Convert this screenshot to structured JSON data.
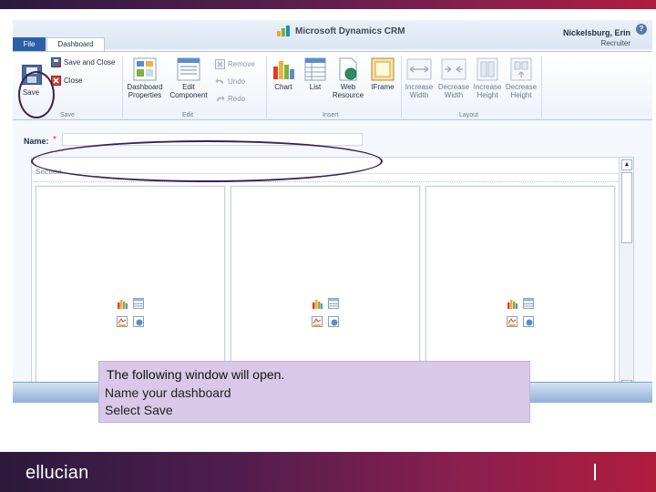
{
  "app": {
    "logo_text": "Microsoft Dynamics CRM",
    "user_name": "Nickelsburg, Erin",
    "user_role": "Recruiter",
    "help_glyph": "?"
  },
  "tabs": [
    {
      "label": "File"
    },
    {
      "label": "Dashboard"
    }
  ],
  "ribbon": {
    "save": {
      "label": "Save"
    },
    "save_and_close": {
      "label": "Save and Close"
    },
    "close": {
      "label": "Close"
    },
    "dashboard_properties": {
      "label_1": "Dashboard",
      "label_2": "Properties"
    },
    "edit_component": {
      "label_1": "Edit",
      "label_2": "Component"
    },
    "remove": {
      "label": "Remove"
    },
    "undo": {
      "label": "Undo"
    },
    "redo": {
      "label": "Redo"
    },
    "chart": {
      "label": "Chart"
    },
    "list": {
      "label": "List"
    },
    "web_resource": {
      "label_1": "Web",
      "label_2": "Resource"
    },
    "iframe": {
      "label": "IFrame"
    },
    "increase_width": {
      "label_1": "Increase",
      "label_2": "Width"
    },
    "decrease_width": {
      "label_1": "Decrease",
      "label_2": "Width"
    },
    "increase_height": {
      "label_1": "Increase",
      "label_2": "Height"
    },
    "decrease_height": {
      "label_1": "Decrease",
      "label_2": "Height"
    },
    "groups": [
      "Save",
      "Edit",
      "Insert",
      "Layout"
    ]
  },
  "form": {
    "name_label": "Name:",
    "required_marker": "*",
    "name_value": ""
  },
  "canvas": {
    "section_label": "Section"
  },
  "caption": {
    "title": "The following window will open.",
    "line1": "Name your dashboard",
    "line2": "Select Save"
  },
  "footer": {
    "logo": "ellucian"
  },
  "colors": {
    "accent_purple": "#3a1f57",
    "caption_bg": "#d9c8e8",
    "tab_file_blue": "#2c5fa7",
    "footer_left": "#2b1a3c",
    "footer_right": "#b01c3e",
    "required_red": "#d03030"
  },
  "icons": [
    "save-icon",
    "save-and-close-icon",
    "close-icon",
    "dashboard-properties-icon",
    "edit-component-icon",
    "remove-icon",
    "undo-icon",
    "redo-icon",
    "chart-icon",
    "list-icon",
    "web-resource-icon",
    "iframe-icon",
    "increase-width-icon",
    "decrease-width-icon",
    "increase-height-icon",
    "decrease-height-icon",
    "help-icon",
    "scroll-up-icon",
    "scroll-down-icon"
  ]
}
